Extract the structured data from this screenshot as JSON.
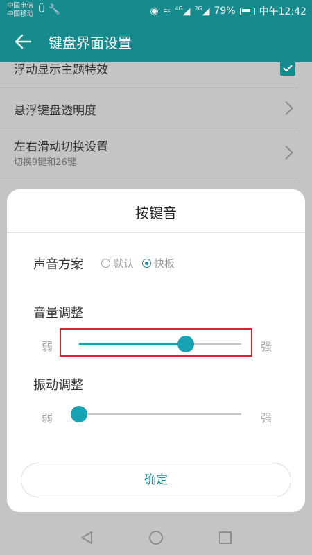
{
  "status_bar": {
    "carrier1": "中国电信",
    "carrier2": "中国移动",
    "signal1": "4G",
    "signal2": "2G",
    "battery": "79%",
    "time": "中午12:42"
  },
  "app_bar": {
    "title": "键盘界面设置"
  },
  "settings": [
    {
      "title": "浮动显示主题特效",
      "checked": true
    },
    {
      "title": "悬浮键盘透明度",
      "subtitle": ""
    },
    {
      "title": "左右滑动切换设置",
      "subtitle": "切换9键和26键"
    }
  ],
  "dialog": {
    "title": "按键音",
    "scheme_label": "声音方案",
    "scheme_options": [
      {
        "label": "默认",
        "selected": false
      },
      {
        "label": "快板",
        "selected": true
      }
    ],
    "volume_label": "音量调整",
    "vibration_label": "振动调整",
    "weak": "弱",
    "strong": "强",
    "volume_level": 0.66,
    "vibration_level": 0,
    "confirm": "确定"
  },
  "colors": {
    "accent": "#178a8d",
    "slider": "#15a2b2",
    "highlight": "#d3292b"
  }
}
